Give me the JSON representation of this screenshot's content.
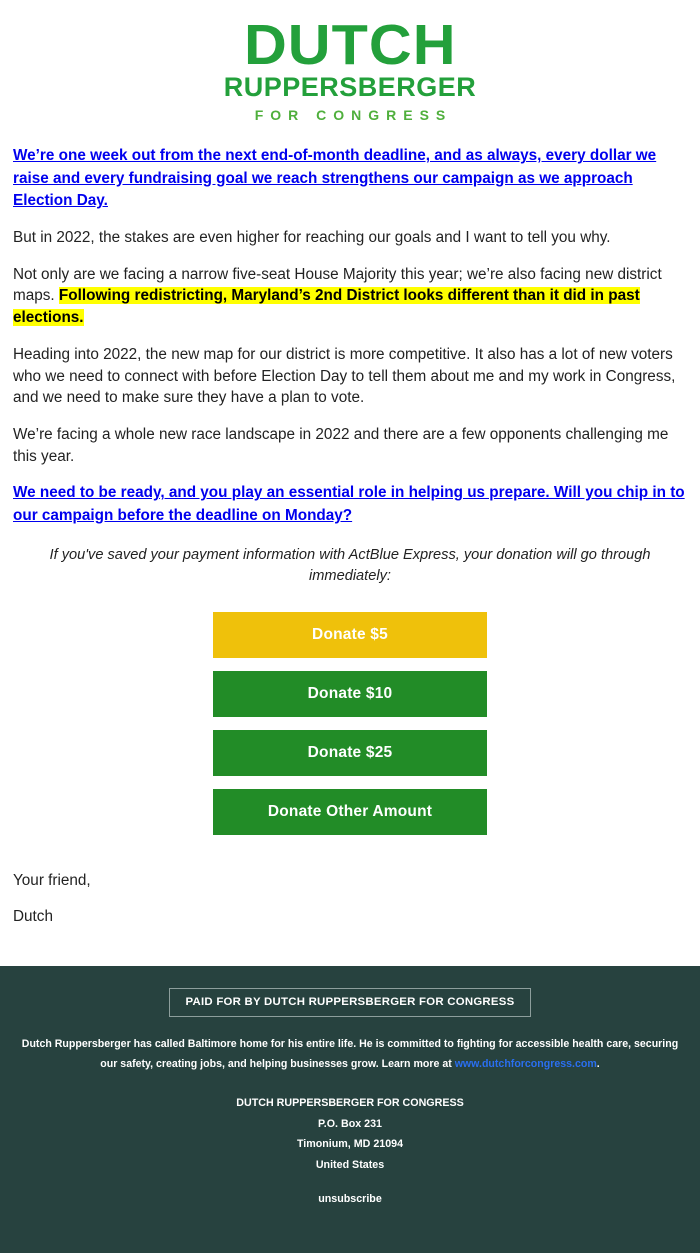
{
  "logo": {
    "main": "DUTCH",
    "sub": "RUPPERSBERGER",
    "tagline": "FOR CONGRESS",
    "color": "#23a03b",
    "tagline_color": "#4faf3c"
  },
  "body": {
    "lead_link": "We’re one week out from the next end-of-month deadline, and as always, every dollar we raise and every fundraising goal we reach strengthens our campaign as we approach Election Day.",
    "para_1": "But in 2022, the stakes are even higher for reaching our goals and I want to tell you why.",
    "para_2_prefix": "Not only are we facing a narrow five-seat House Majority this year; we’re also facing new district maps. ",
    "para_2_highlight": "Following redistricting, Maryland’s 2nd District looks different than it did in past elections.",
    "para_3": "Heading into 2022, the new map for our district is more competitive. It also has a lot of new voters who we need to connect with before Election Day to tell them about me and my work in Congress, and we need to make sure they have a plan to vote.",
    "para_4": "We’re facing a whole new race landscape in 2022 and there are a few opponents challenging me this year.",
    "cta_link": "We need to be ready, and you play an essential role in helping us prepare. Will you chip in to our campaign before the deadline on Monday?",
    "actblue_note": "If you've saved your payment information with ActBlue Express, your donation will go through immediately:",
    "highlight_color": "#ffff00",
    "link_color": "#0000ee"
  },
  "donate_buttons": [
    {
      "label": "Donate $5",
      "color": "#efc10b",
      "style": "gold"
    },
    {
      "label": "Donate $10",
      "color": "#228c27",
      "style": "green"
    },
    {
      "label": "Donate $25",
      "color": "#228c27",
      "style": "green"
    },
    {
      "label": "Donate Other Amount",
      "color": "#228c27",
      "style": "green"
    }
  ],
  "signature": {
    "closing": "Your friend,",
    "name": "Dutch"
  },
  "footer": {
    "background": "#27423f",
    "disclaimer": "PAID FOR BY DUTCH RUPPERSBERGER FOR CONGRESS",
    "bio_text_1": "Dutch Ruppersberger has called Baltimore home for his entire life. He is committed to fighting for accessible health care, securing our safety, creating jobs, and helping businesses grow. Learn more at ",
    "bio_link": "www.dutchforcongress.com",
    "bio_text_2": ".",
    "link_color": "#2a6ff0",
    "address": {
      "organization": "DUTCH RUPPERSBERGER FOR CONGRESS",
      "po_box": "P.O. Box 231",
      "city_state_zip": "Timonium, MD 21094",
      "country": "United States"
    },
    "unsubscribe": "unsubscribe"
  }
}
